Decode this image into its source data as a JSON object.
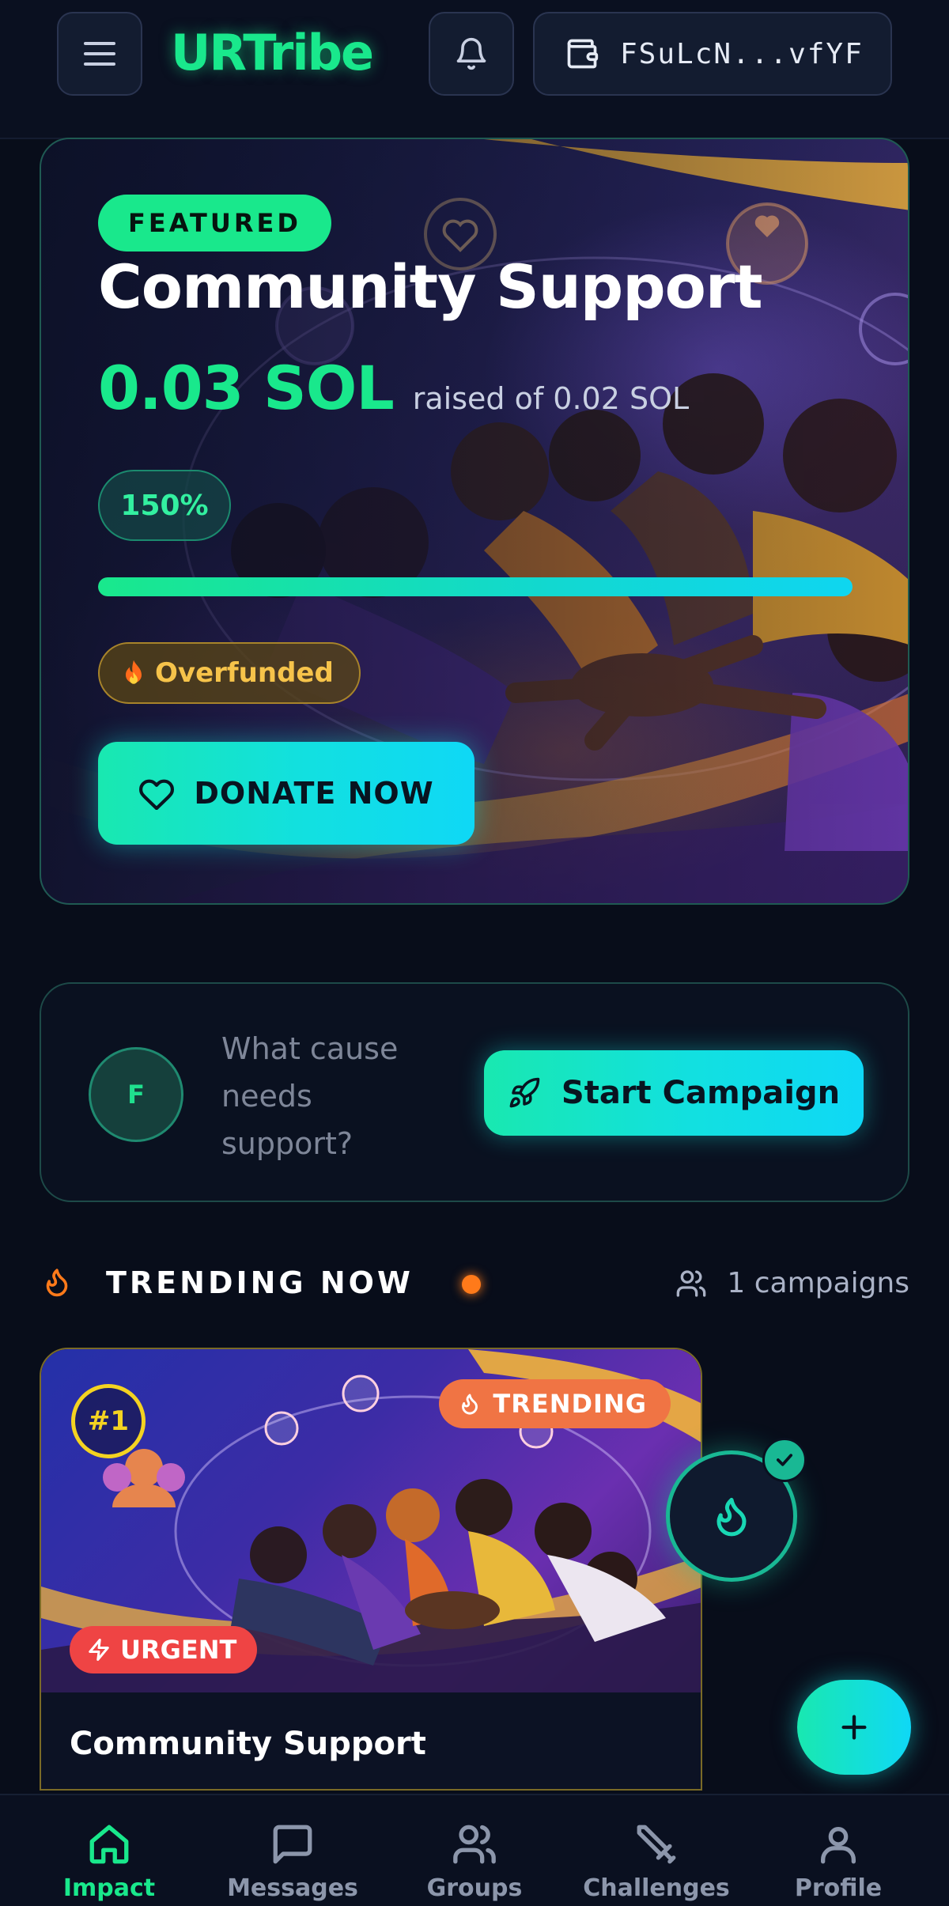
{
  "header": {
    "brand": "URTribe",
    "wallet_address": "FSuLcN...vfYF"
  },
  "featured": {
    "badge": "FEATURED",
    "title": "Community Support",
    "raised": "0.03 SOL",
    "goal_text": "raised of 0.02 SOL",
    "percent_label": "150%",
    "progress": 1.0,
    "status": "Overfunded",
    "donate_label": "DONATE NOW"
  },
  "composer": {
    "avatar_initial": "F",
    "prompt": "What cause needs support?",
    "button_label": "Start Campaign"
  },
  "trending": {
    "title": "TRENDING NOW",
    "count_label": "1 campaigns",
    "cards": [
      {
        "rank": "#1",
        "badge": "TRENDING",
        "urgency": "URGENT",
        "title": "Community Support"
      }
    ]
  },
  "nav": {
    "items": [
      {
        "label": "Impact",
        "icon": "home-icon",
        "active": true
      },
      {
        "label": "Messages",
        "icon": "message-icon",
        "active": false
      },
      {
        "label": "Groups",
        "icon": "users-icon",
        "active": false
      },
      {
        "label": "Challenges",
        "icon": "sword-icon",
        "active": false
      },
      {
        "label": "Profile",
        "icon": "user-icon",
        "active": false
      }
    ]
  },
  "colors": {
    "accent": "#19e88c",
    "cyan": "#0fd8f6",
    "background": "#080d1a",
    "warning": "#f6c34a",
    "urgent": "#ef4444",
    "trending": "#f07444"
  }
}
